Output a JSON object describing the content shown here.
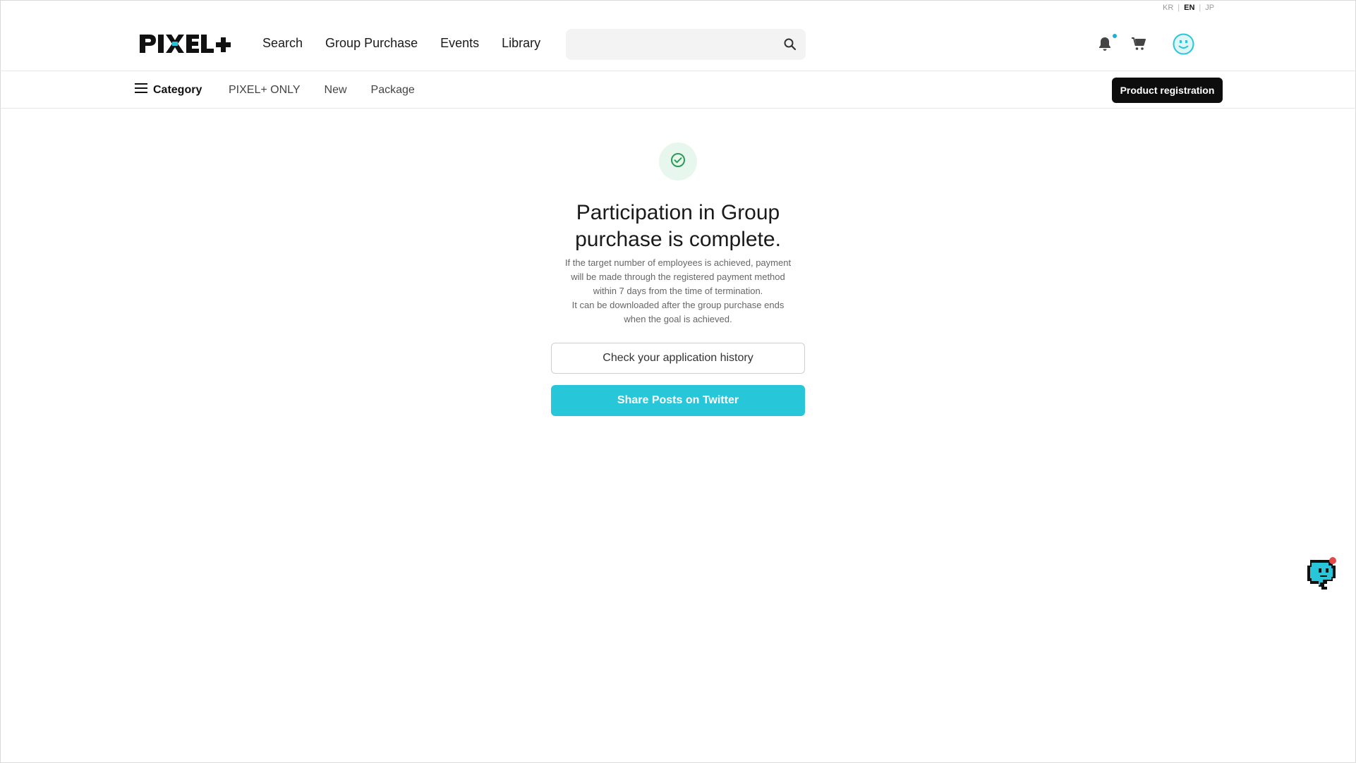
{
  "language": {
    "options": [
      "KR",
      "EN",
      "JP"
    ],
    "active": "EN",
    "separator": "|"
  },
  "brand": {
    "logo_text": "PIXEL+"
  },
  "nav": {
    "items": [
      {
        "label": "Search"
      },
      {
        "label": "Group Purchase"
      },
      {
        "label": "Events"
      },
      {
        "label": "Library"
      }
    ]
  },
  "search": {
    "placeholder": "",
    "value": "",
    "icon": "search-icon"
  },
  "header_icons": {
    "notifications": "bell-icon",
    "notification_dot": true,
    "cart": "cart-icon",
    "profile": "smiley-avatar-icon"
  },
  "category_bar": {
    "menu_label": "Category",
    "links": [
      "PIXEL+ ONLY",
      "New",
      "Package"
    ],
    "product_registration_label": "Product registration"
  },
  "confirmation": {
    "icon": "check-circle-icon",
    "title_line1": "Participation in Group",
    "title_line2": "purchase is complete.",
    "desc_lines": [
      "If the target number of employees is achieved, payment",
      "will be made through the registered payment method",
      "within 7 days from the time of termination.",
      "It can be downloaded after the group purchase ends",
      "when the goal is achieved."
    ],
    "history_button_label": "Check your application history",
    "twitter_button_label": "Share Posts on Twitter"
  },
  "chat_widget": {
    "icon": "chat-mascot-icon",
    "badge": true
  },
  "colors": {
    "accent": "#27c6d9",
    "dark_button": "#0d0d0d",
    "success_bg": "#e8f7ed",
    "success": "#2d9b55"
  }
}
